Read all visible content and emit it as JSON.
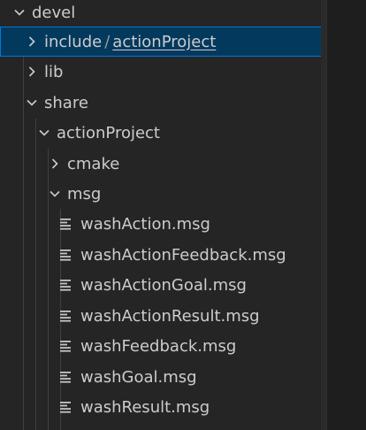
{
  "tree": {
    "root": {
      "label": "devel",
      "expanded": true
    },
    "include": {
      "label": "include",
      "separator": "/",
      "child": "actionProject",
      "expanded": false,
      "selected": true
    },
    "lib": {
      "label": "lib",
      "expanded": false
    },
    "share": {
      "label": "share",
      "expanded": true
    },
    "actionProject": {
      "label": "actionProject",
      "expanded": true
    },
    "cmake": {
      "label": "cmake",
      "expanded": false
    },
    "msg": {
      "label": "msg",
      "expanded": true
    },
    "files": [
      {
        "label": "washAction.msg",
        "icon": "lines-file-icon"
      },
      {
        "label": "washActionFeedback.msg",
        "icon": "lines-file-icon"
      },
      {
        "label": "washActionGoal.msg",
        "icon": "lines-file-icon"
      },
      {
        "label": "washActionResult.msg",
        "icon": "lines-file-icon"
      },
      {
        "label": "washFeedback.msg",
        "icon": "lines-file-icon"
      },
      {
        "label": "washGoal.msg",
        "icon": "lines-file-icon"
      },
      {
        "label": "washResult.msg",
        "icon": "lines-file-icon"
      }
    ]
  },
  "colors": {
    "background": "#252526",
    "selected_background": "#04395e",
    "selected_border": "#0078d4",
    "text": "#cccccc"
  }
}
